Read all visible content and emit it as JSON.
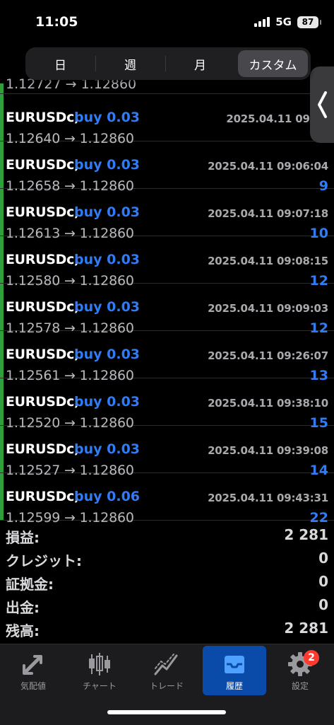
{
  "status": {
    "time": "11:05",
    "network": "5G",
    "battery": "87"
  },
  "period_tabs": [
    {
      "label": "日",
      "active": false
    },
    {
      "label": "週",
      "active": false
    },
    {
      "label": "月",
      "active": false
    },
    {
      "label": "カスタム",
      "active": true
    }
  ],
  "top_stub": "1.12727 → 1.12860",
  "trades": [
    {
      "symbol": "EURUSDc,",
      "side": "buy 0.03",
      "date": "2025.04.11 09:04",
      "prices": "1.12640 → 1.12860",
      "profit": ""
    },
    {
      "symbol": "EURUSDc,",
      "side": "buy 0.03",
      "date": "2025.04.11 09:06:04",
      "prices": "1.12658 → 1.12860",
      "profit": "9"
    },
    {
      "symbol": "EURUSDc,",
      "side": "buy 0.03",
      "date": "2025.04.11 09:07:18",
      "prices": "1.12613 → 1.12860",
      "profit": "10"
    },
    {
      "symbol": "EURUSDc,",
      "side": "buy 0.03",
      "date": "2025.04.11 09:08:15",
      "prices": "1.12580 → 1.12860",
      "profit": "12"
    },
    {
      "symbol": "EURUSDc,",
      "side": "buy 0.03",
      "date": "2025.04.11 09:09:03",
      "prices": "1.12578 → 1.12860",
      "profit": "12"
    },
    {
      "symbol": "EURUSDc,",
      "side": "buy 0.03",
      "date": "2025.04.11 09:26:07",
      "prices": "1.12561 → 1.12860",
      "profit": "13"
    },
    {
      "symbol": "EURUSDc,",
      "side": "buy 0.03",
      "date": "2025.04.11 09:38:10",
      "prices": "1.12520 → 1.12860",
      "profit": "15"
    },
    {
      "symbol": "EURUSDc,",
      "side": "buy 0.03",
      "date": "2025.04.11 09:39:08",
      "prices": "1.12527 → 1.12860",
      "profit": "14"
    },
    {
      "symbol": "EURUSDc,",
      "side": "buy 0.06",
      "date": "2025.04.11 09:43:31",
      "prices": "1.12599 → 1.12860",
      "profit": "22"
    }
  ],
  "summary": [
    {
      "label": "損益:",
      "value": "2 281"
    },
    {
      "label": "クレジット:",
      "value": "0"
    },
    {
      "label": "証拠金:",
      "value": "0"
    },
    {
      "label": "出金:",
      "value": "0"
    },
    {
      "label": "残高:",
      "value": "2 281"
    }
  ],
  "tabbar": [
    {
      "label": "気配値",
      "icon": "quotes-arrows-icon"
    },
    {
      "label": "チャート",
      "icon": "candlestick-icon"
    },
    {
      "label": "トレード",
      "icon": "trade-chart-icon"
    },
    {
      "label": "履歴",
      "icon": "inbox-history-icon"
    },
    {
      "label": "設定",
      "icon": "gear-icon",
      "badge": "2"
    }
  ],
  "colors": {
    "buy": "#2f7cf6",
    "long_bar": "#2fa13a",
    "active_tab": "#0a4aa8",
    "badge": "#ff3b30"
  }
}
